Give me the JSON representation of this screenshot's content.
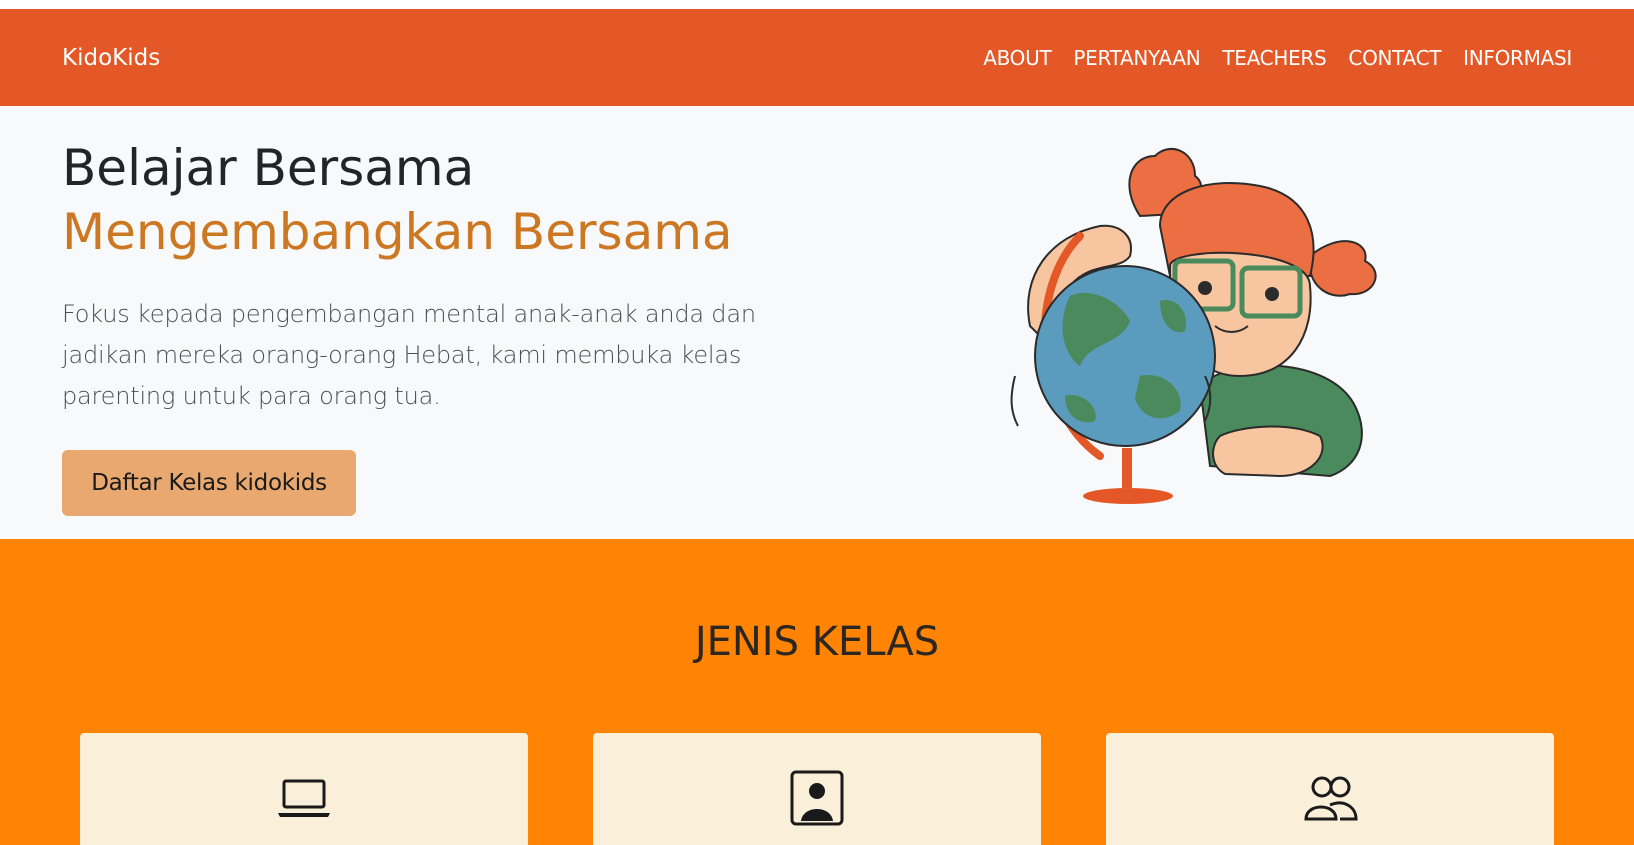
{
  "nav": {
    "brand": "KidoKids",
    "links": [
      "ABOUT",
      "PERTANYAAN",
      "TEACHERS",
      "CONTACT",
      "INFORMASI"
    ]
  },
  "hero": {
    "title_line1": "Belajar Bersama",
    "title_line2": "Mengembangkan Bersama",
    "description": "Fokus kepada pengembangan mental anak-anak anda dan jadikan mereka orang-orang Hebat, kami membuka kelas parenting untuk para orang tua.",
    "cta_label": "Daftar Kelas kidokids",
    "illustration_icon": "child-with-globe-illustration"
  },
  "classes": {
    "title": "JENIS KELAS",
    "cards": [
      {
        "icon": "laptop-icon"
      },
      {
        "icon": "person-square-icon"
      },
      {
        "icon": "people-icon"
      }
    ]
  },
  "colors": {
    "navbar": "#e35826",
    "hero_bg": "#f8f9fa",
    "accent_text": "#cc7722",
    "button": "#e8a870",
    "section_bg": "#ff8403",
    "card_bg": "#faefd8"
  }
}
